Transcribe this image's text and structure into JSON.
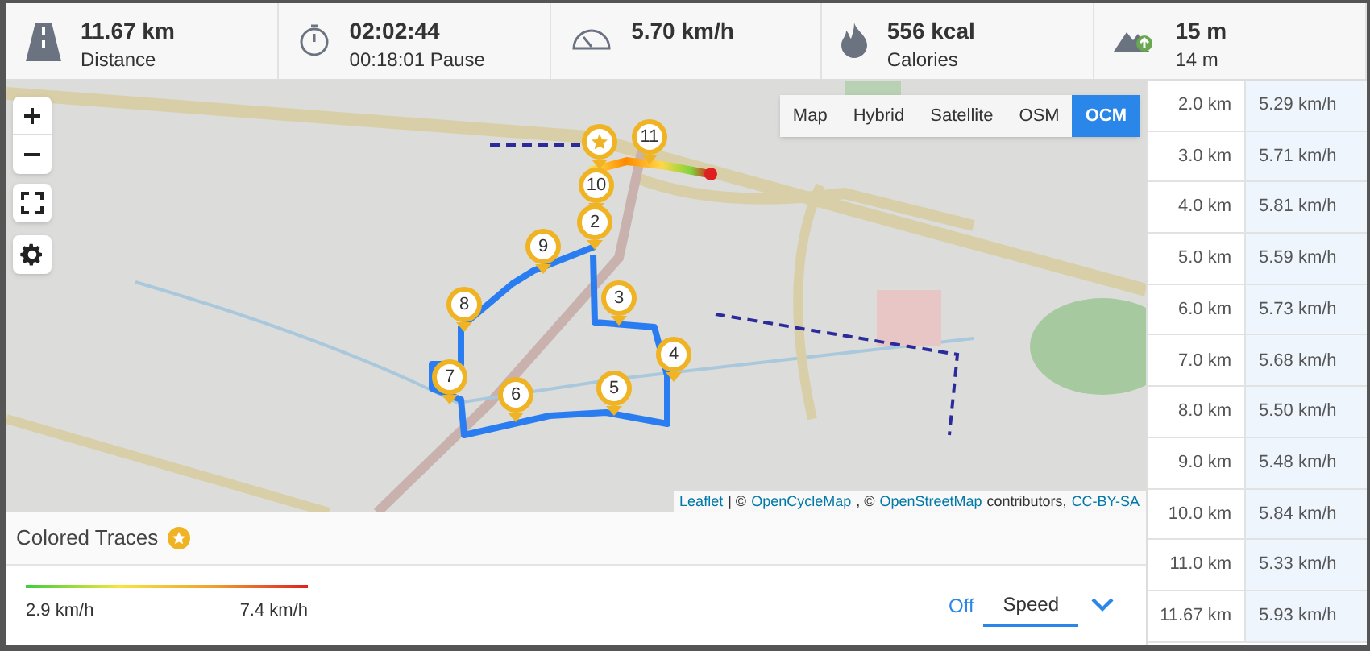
{
  "stats": [
    {
      "kind": "distance",
      "value": "11.67 km",
      "label": "Distance"
    },
    {
      "kind": "time",
      "value": "02:02:44",
      "label": "00:18:01 Pause"
    },
    {
      "kind": "speed",
      "value": "5.70 km/h"
    },
    {
      "kind": "calories",
      "value": "556 kcal",
      "label": "Calories"
    },
    {
      "kind": "elevation",
      "value": "15 m",
      "label": "14 m"
    }
  ],
  "map": {
    "layers": [
      {
        "label": "Map",
        "selected": false
      },
      {
        "label": "Hybrid",
        "selected": false
      },
      {
        "label": "Satellite",
        "selected": false
      },
      {
        "label": "OSM",
        "selected": false
      },
      {
        "label": "OCM",
        "selected": true
      }
    ],
    "markers": [
      {
        "kind": "start"
      },
      {
        "kind": "number",
        "label": "11"
      },
      {
        "kind": "number",
        "label": "10"
      },
      {
        "kind": "number",
        "label": "2"
      },
      {
        "kind": "number",
        "label": "9"
      },
      {
        "kind": "number",
        "label": "3"
      },
      {
        "kind": "number",
        "label": "8"
      },
      {
        "kind": "number",
        "label": "4"
      },
      {
        "kind": "number",
        "label": "7"
      },
      {
        "kind": "number",
        "label": "6"
      },
      {
        "kind": "number",
        "label": "5"
      }
    ],
    "attribution": {
      "leaflet": "Leaflet",
      "sep": "| ©",
      "ocm": "OpenCycleMap",
      "sep2": ", ©",
      "osm": "OpenStreetMap",
      "contributors": "contributors,",
      "license": "CC-BY-SA"
    }
  },
  "colored_traces": {
    "title": "Colored Traces",
    "min": "2.9 km/h",
    "max": "7.4 km/h",
    "modes": [
      {
        "label": "Off",
        "selected": false
      },
      {
        "label": "Speed",
        "selected": true
      }
    ]
  },
  "splits": [
    {
      "distance": "2.0 km",
      "speed": "5.29 km/h"
    },
    {
      "distance": "3.0 km",
      "speed": "5.71 km/h"
    },
    {
      "distance": "4.0 km",
      "speed": "5.81 km/h"
    },
    {
      "distance": "5.0 km",
      "speed": "5.59 km/h"
    },
    {
      "distance": "6.0 km",
      "speed": "5.73 km/h"
    },
    {
      "distance": "7.0 km",
      "speed": "5.68 km/h"
    },
    {
      "distance": "8.0 km",
      "speed": "5.50 km/h"
    },
    {
      "distance": "9.0 km",
      "speed": "5.48 km/h"
    },
    {
      "distance": "10.0 km",
      "speed": "5.84 km/h"
    },
    {
      "distance": "11.0 km",
      "speed": "5.33 km/h"
    },
    {
      "distance": "11.67 km",
      "speed": "5.93 km/h"
    }
  ]
}
